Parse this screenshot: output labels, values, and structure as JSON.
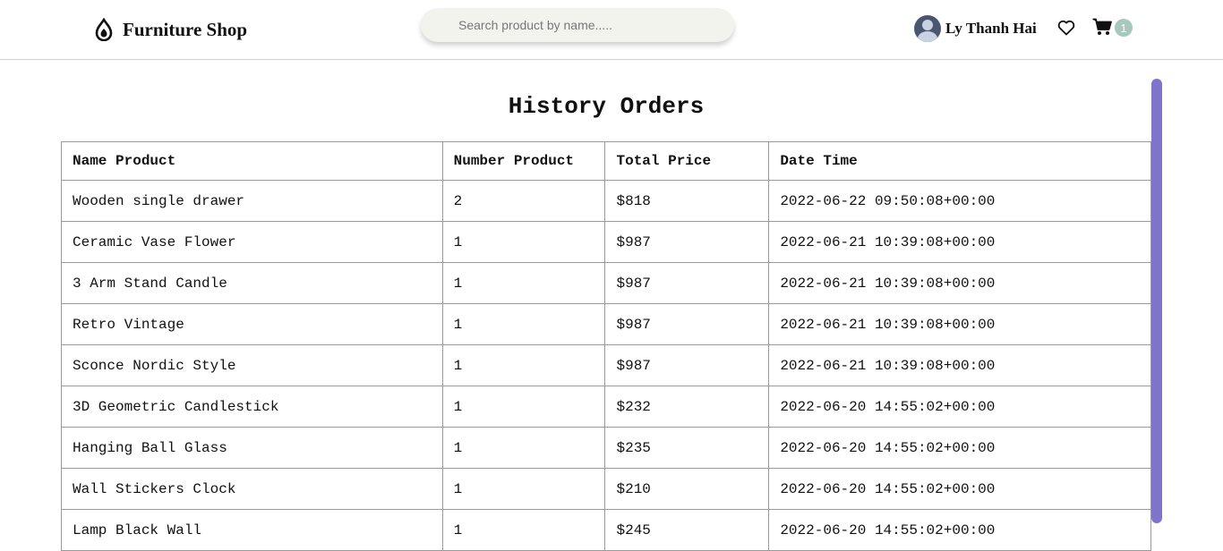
{
  "header": {
    "brand_name": "Furniture Shop",
    "search_placeholder": "Search product by name.....",
    "user_name": "Ly Thanh Hai",
    "cart_count": "1"
  },
  "page": {
    "title": "History Orders"
  },
  "orders_table": {
    "columns": [
      "Name Product",
      "Number Product",
      "Total Price",
      "Date Time"
    ],
    "rows": [
      [
        "Wooden single drawer",
        "2",
        "$818",
        "2022-06-22 09:50:08+00:00"
      ],
      [
        "Ceramic Vase Flower",
        "1",
        "$987",
        "2022-06-21 10:39:08+00:00"
      ],
      [
        "3 Arm Stand Candle",
        "1",
        "$987",
        "2022-06-21 10:39:08+00:00"
      ],
      [
        "Retro Vintage",
        "1",
        "$987",
        "2022-06-21 10:39:08+00:00"
      ],
      [
        "Sconce Nordic Style",
        "1",
        "$987",
        "2022-06-21 10:39:08+00:00"
      ],
      [
        "3D Geometric Candlestick",
        "1",
        "$232",
        "2022-06-20 14:55:02+00:00"
      ],
      [
        "Hanging Ball Glass",
        "1",
        "$235",
        "2022-06-20 14:55:02+00:00"
      ],
      [
        "Wall Stickers Clock",
        "1",
        "$210",
        "2022-06-20 14:55:02+00:00"
      ],
      [
        "Lamp Black Wall",
        "1",
        "$245",
        "2022-06-20 14:55:02+00:00"
      ]
    ]
  },
  "colors": {
    "scrollbar": "#7f74cc",
    "badge": "#a9c7bd",
    "search_bg": "#f3f3ee"
  },
  "icons": [
    "logo-drop-icon",
    "user-avatar",
    "heart-icon",
    "cart-icon"
  ]
}
